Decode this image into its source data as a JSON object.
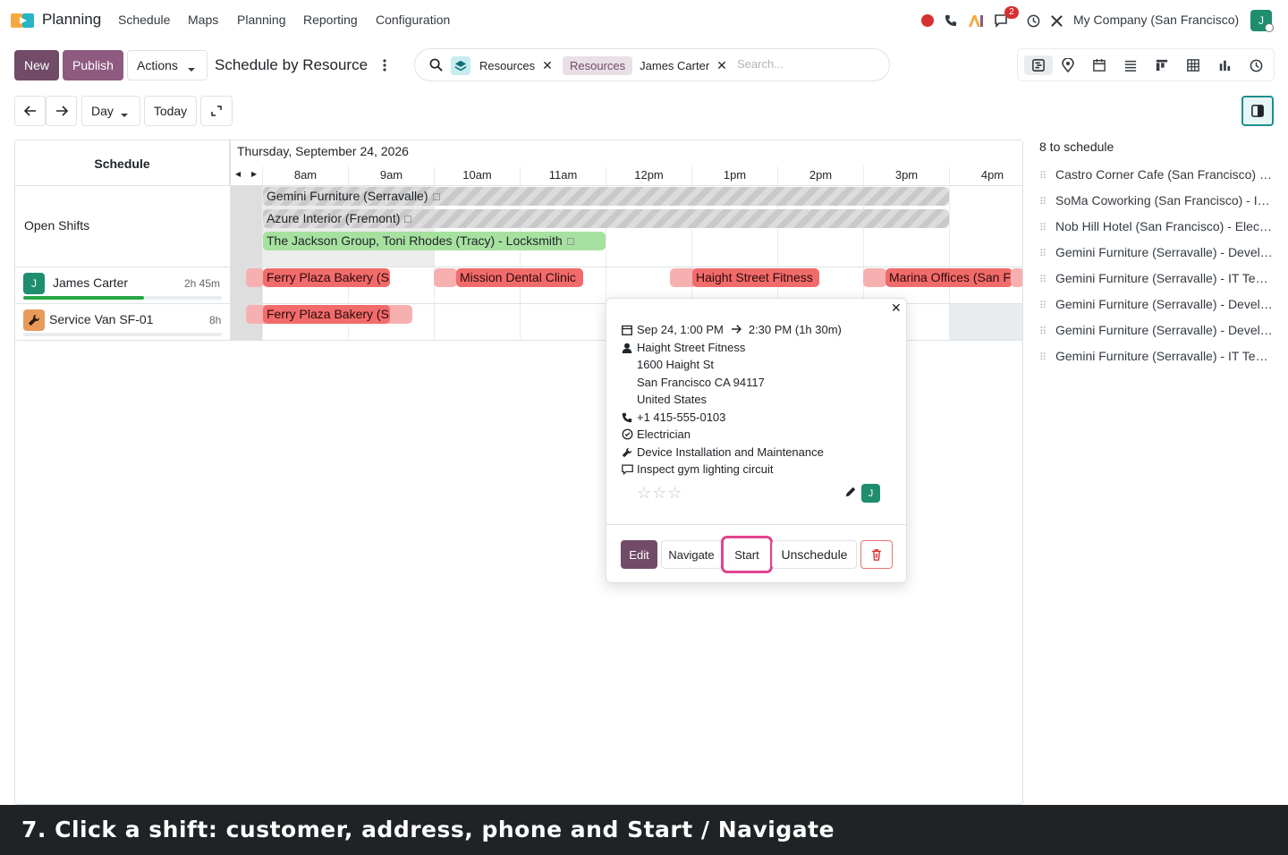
{
  "topnav": {
    "app_name": "Planning",
    "menu": [
      "Schedule",
      "Maps",
      "Planning",
      "Reporting",
      "Configuration"
    ],
    "message_count": "2",
    "company": "My Company (San Francisco)",
    "user_initial": "J"
  },
  "control": {
    "new_label": "New",
    "publish_label": "Publish",
    "actions_label": "Actions",
    "page_title": "Schedule by Resource",
    "prev_icon": "arrow-left-icon",
    "next_icon": "arrow-right-icon",
    "scale_label": "Day",
    "today_label": "Today"
  },
  "search": {
    "facet1_label": "Resources",
    "facet2_field": "Resources",
    "facet2_value": "James Carter",
    "placeholder": "Search..."
  },
  "gantt": {
    "row_header": "Schedule",
    "date_label": "Thursday, September 24, 2026",
    "hours": [
      "8am",
      "9am",
      "10am",
      "11am",
      "12pm",
      "1pm",
      "2pm",
      "3pm",
      "4pm"
    ],
    "rows": {
      "open_shifts": "Open Shifts",
      "james": {
        "initial": "J",
        "name": "James Carter",
        "hours": "2h 45m",
        "progress_pct": 61
      },
      "van": {
        "name": "Service Van SF-01",
        "hours": "8h",
        "progress_pct": 0
      }
    },
    "pills": {
      "open1": "Gemini Furniture (Serravalle)",
      "open2": "Azure Interior (Fremont)",
      "open3": "The Jackson Group, Toni Rhodes (Tracy) - Locksmith",
      "j1": "Ferry Plaza Bakery (S",
      "j2": "Mission Dental Clinic",
      "j3": "Haight Street Fitness",
      "j4": "Marina Offices (San F",
      "v1": "Ferry Plaza Bakery (S"
    }
  },
  "popover": {
    "start": "Sep 24, 1:00 PM",
    "end": "2:30 PM (1h 30m)",
    "customer": "Haight Street Fitness",
    "address1": "1600 Haight St",
    "address2": "San Francisco CA 94117",
    "address3": "United States",
    "phone": "+1 415-555-0103",
    "role": "Electrician",
    "service": "Device Installation and Maintenance",
    "description": "Inspect gym lighting circuit",
    "rating": 0,
    "assignee_initial": "J",
    "buttons": {
      "edit": "Edit",
      "navigate": "Navigate",
      "start": "Start",
      "unschedule": "Unschedule"
    }
  },
  "right_panel": {
    "title": "8 to schedule",
    "items": [
      "Castro Corner Cafe (San Francisco) - Electrician",
      "SoMa Coworking (San Francisco) - IT Technician",
      "Nob Hill Hotel (San Francisco) - Electrician",
      "Gemini Furniture (Serravalle) - Developer",
      "Gemini Furniture (Serravalle) - IT Technician",
      "Gemini Furniture (Serravalle) - Developer",
      "Gemini Furniture (Serravalle) - Developer",
      "Gemini Furniture (Serravalle) - IT Technician"
    ]
  },
  "caption": "7. Click a shift: customer, address, phone and Start / Navigate",
  "colors": {
    "brand": "#714b67",
    "publish": "#8f5a80",
    "shift_red": "#f26b6b",
    "shift_green": "#a7e1a0",
    "avatar_green": "#1e8e6e",
    "start_highlight": "#e0438d"
  }
}
